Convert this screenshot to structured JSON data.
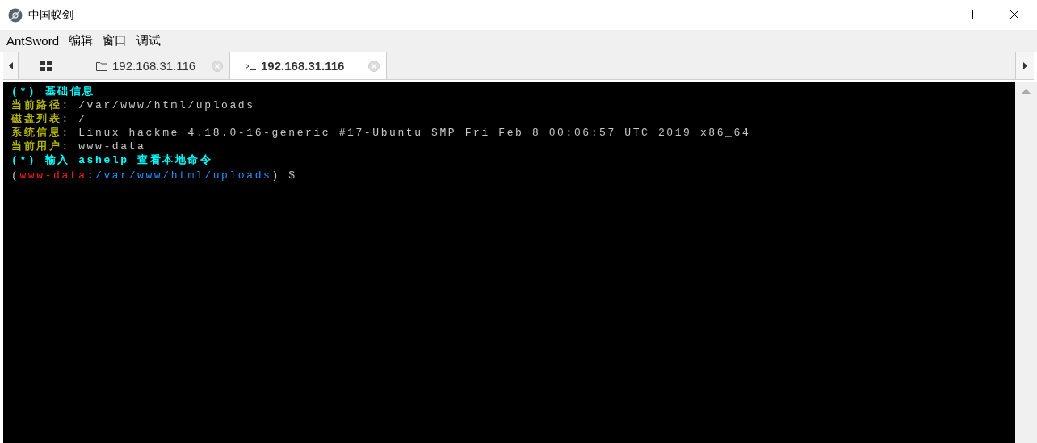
{
  "window": {
    "title": "中国蚁剑"
  },
  "menu": [
    {
      "label": "AntSword"
    },
    {
      "label": "编辑"
    },
    {
      "label": "窗口"
    },
    {
      "label": "调试"
    }
  ],
  "tabs": [
    {
      "kind": "home",
      "selected": false
    },
    {
      "kind": "files",
      "label": "192.168.31.116",
      "selected": false
    },
    {
      "kind": "terminal",
      "label": "192.168.31.116",
      "selected": true
    }
  ],
  "terminal": {
    "lines": [
      [
        {
          "kind": "heading",
          "text": "(*) 基础信息"
        }
      ],
      [
        {
          "kind": "label",
          "text": "当前路径"
        },
        {
          "kind": "plain",
          "text": ": /var/www/html/uploads"
        }
      ],
      [
        {
          "kind": "label",
          "text": "磁盘列表"
        },
        {
          "kind": "plain",
          "text": ": /"
        }
      ],
      [
        {
          "kind": "label",
          "text": "系统信息"
        },
        {
          "kind": "plain",
          "text": ": Linux hackme 4.18.0-16-generic #17-Ubuntu SMP Fri Feb 8 00:06:57 UTC 2019 x86_64"
        }
      ],
      [
        {
          "kind": "label",
          "text": "当前用户"
        },
        {
          "kind": "plain",
          "text": ": www-data"
        }
      ],
      [
        {
          "kind": "heading",
          "text": "(*) 输入 ashelp 查看本地命令"
        }
      ],
      [
        {
          "kind": "plain",
          "text": "("
        },
        {
          "kind": "user",
          "text": "www-data"
        },
        {
          "kind": "plain",
          "text": ":"
        },
        {
          "kind": "path",
          "text": "/var/www/html/uploads"
        },
        {
          "kind": "plain",
          "text": ") $"
        }
      ]
    ]
  }
}
